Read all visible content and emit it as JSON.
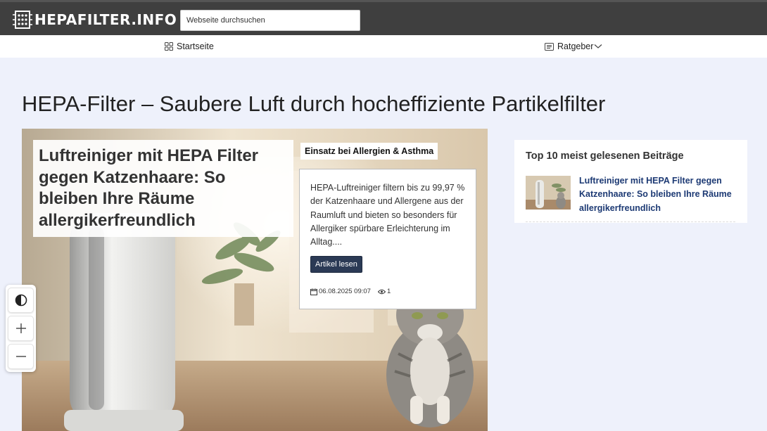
{
  "header": {
    "logo_text": "HEPAFILTER.INFO",
    "search_placeholder": "Webseite durchsuchen"
  },
  "nav": {
    "items": [
      {
        "label": "Startseite",
        "icon": "grid-icon"
      },
      {
        "label": "Ratgeber",
        "icon": "list-icon",
        "has_dropdown": true
      }
    ]
  },
  "page": {
    "title": "HEPA-Filter – Saubere Luft durch hocheffiziente Partikelfilter"
  },
  "featured": {
    "title": "Luftreiniger mit HEPA Filter gegen Katzenhaare: So bleiben Ihre Räume allergikerfreundlich",
    "category": "Einsatz bei Allergien & Asthma",
    "excerpt": "HEPA-Luftreiniger filtern bis zu 99,97 % der Katzenhaare und Allergene aus der Raumluft und bieten so besonders für Allergiker spürbare Erleichterung im Alltag....",
    "button_label": "Artikel lesen",
    "date": "06.08.2025 09:07",
    "views": "1"
  },
  "sidebar": {
    "title": "Top 10 meist gelesenen Beiträge",
    "items": [
      {
        "title": "Luftreiniger mit HEPA Filter gegen Katzenhaare: So bleiben Ihre Räume allergikerfreundlich"
      }
    ]
  },
  "accessibility": {
    "buttons": [
      "contrast-icon",
      "zoom-in-icon",
      "zoom-out-icon"
    ]
  },
  "colors": {
    "topbar": "#3f3f3f",
    "accent_button": "#2b3a55",
    "link": "#1d3a74",
    "page_bg": "#eef1fb"
  }
}
